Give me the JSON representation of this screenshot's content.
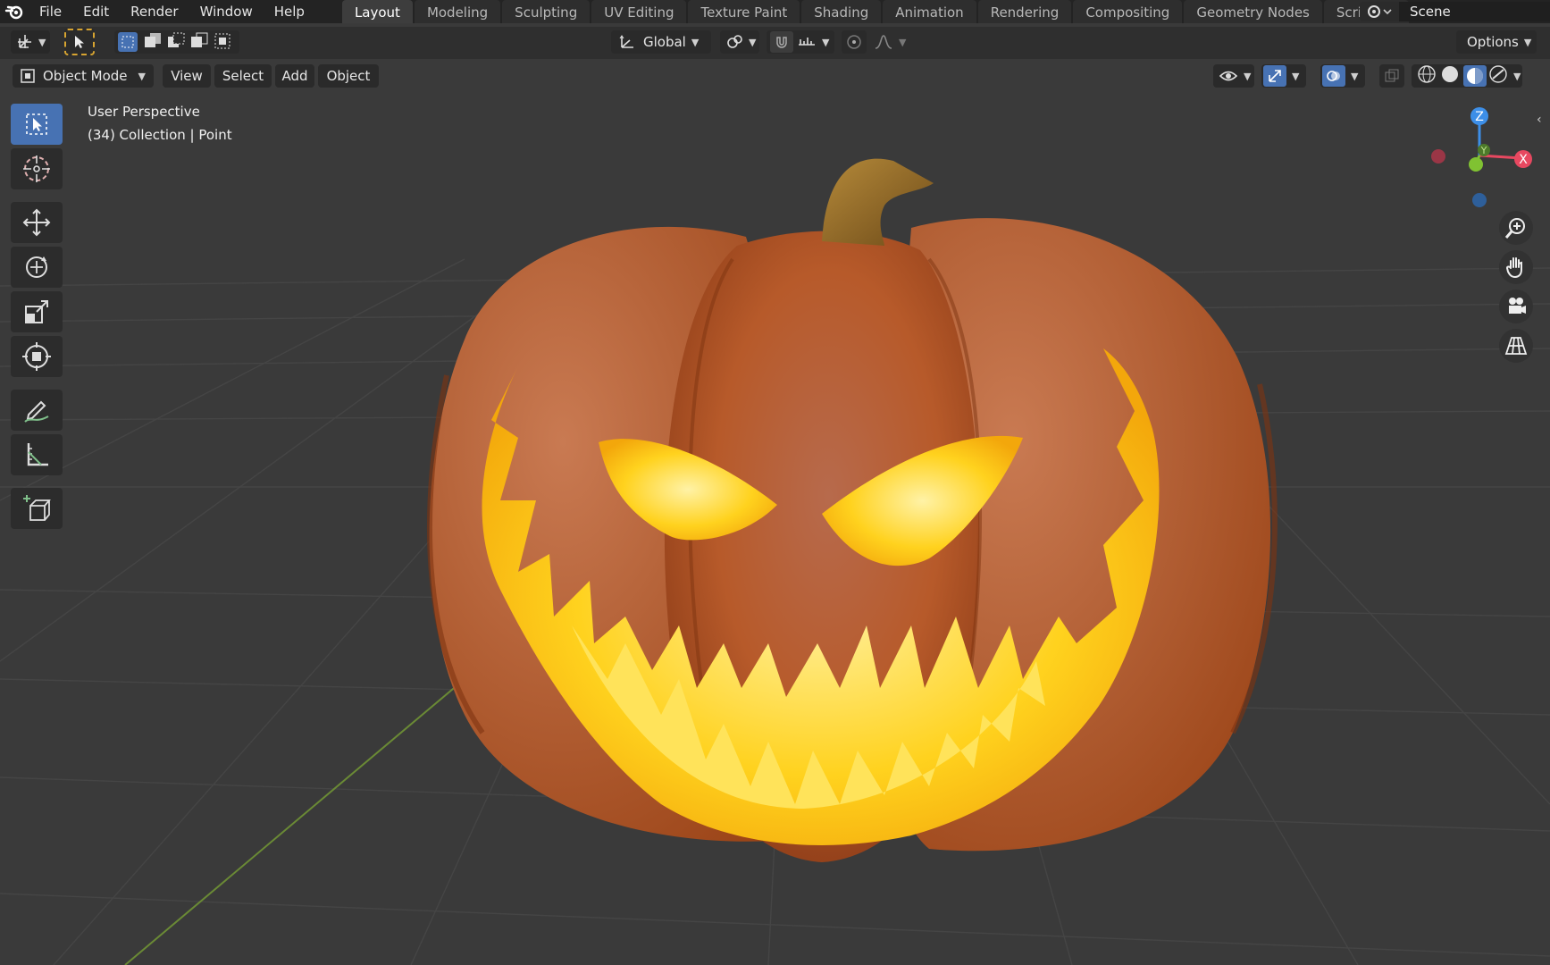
{
  "menu": [
    "File",
    "Edit",
    "Render",
    "Window",
    "Help"
  ],
  "workspace_tabs": [
    "Layout",
    "Modeling",
    "Sculpting",
    "UV Editing",
    "Texture Paint",
    "Shading",
    "Animation",
    "Rendering",
    "Compositing",
    "Geometry Nodes",
    "Scripting"
  ],
  "active_tab": "Layout",
  "scene": {
    "label": "Scene"
  },
  "header": {
    "orientation_label": "Global",
    "options_label": "Options"
  },
  "viewport_header": {
    "mode_label": "Object Mode",
    "menu": [
      "View",
      "Select",
      "Add",
      "Object"
    ]
  },
  "viewport": {
    "perspective_label": "User Perspective",
    "collection_label": "(34) Collection | Point"
  },
  "gizmo": {
    "x_label": "X",
    "y_label": "Y",
    "z_label": "Z"
  },
  "tools": [
    "select-box",
    "cursor",
    "move",
    "rotate",
    "scale",
    "transform",
    "annotate",
    "measure",
    "add-cube"
  ],
  "colors": {
    "topbar": "#232323",
    "active_tool": "#4772b3",
    "axis_x": "#e74860",
    "axis_y": "#80c232",
    "axis_z": "#3d8fe8"
  }
}
